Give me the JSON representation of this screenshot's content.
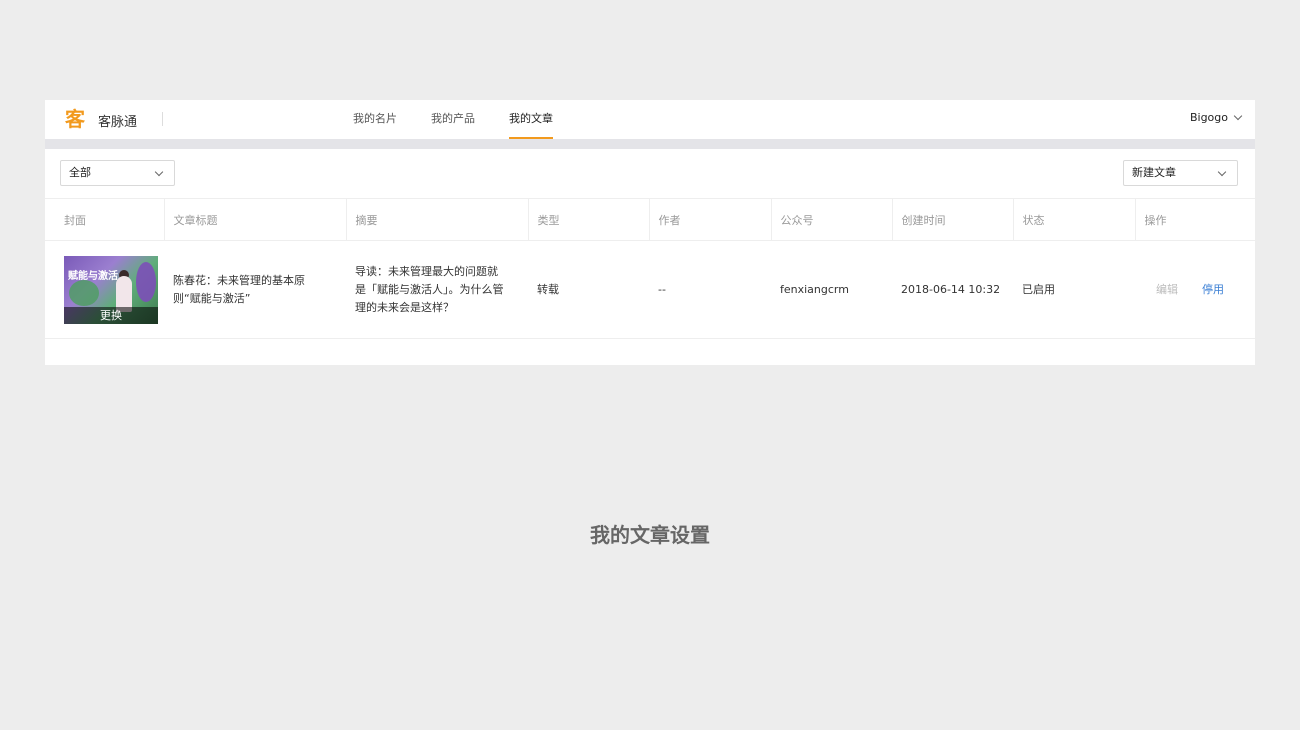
{
  "header": {
    "logo_mark": "客",
    "app_name": "客脉通",
    "nav": [
      {
        "label": "我的名片"
      },
      {
        "label": "我的产品"
      },
      {
        "label": "我的文章"
      }
    ],
    "user": "Bigogo"
  },
  "toolbar": {
    "filter_value": "全部",
    "new_article": "新建文章"
  },
  "table": {
    "columns": [
      "封面",
      "文章标题",
      "摘要",
      "类型",
      "作者",
      "公众号",
      "创建时间",
      "状态",
      "操作"
    ],
    "rows": [
      {
        "cover_title": "赋能与激活",
        "cover_action": "更换",
        "title": "陈春花：未来管理的基本原则“赋能与激活”",
        "summary": "导读：未来管理最大的问题就是「赋能与激活人」。为什么管理的未来会是这样？",
        "type": "转载",
        "author": "--",
        "account": "fenxiangcrm",
        "created": "2018-06-14 10:32",
        "status": "已启用",
        "edit": "编辑",
        "disable": "停用"
      }
    ]
  },
  "caption": "我的文章设置",
  "colors": {
    "accent": "#f29a1e",
    "link": "#3b7fd4"
  }
}
